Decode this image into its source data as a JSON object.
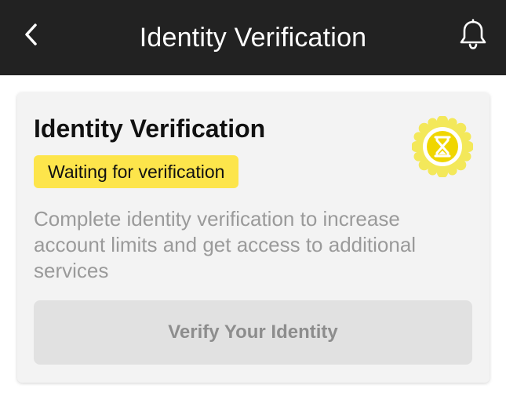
{
  "header": {
    "title": "Identity Verification",
    "back_icon": "chevron-left-icon",
    "notification_icon": "bell-icon",
    "background_color": "#222222"
  },
  "card": {
    "title": "Identity Verification",
    "status_badge": "Waiting for verification",
    "status_color": "#fde54b",
    "badge_icon": "hourglass-seal-icon",
    "description": "Complete identity verification to increase account limits and get access to additional services",
    "verify_button": "Verify Your Identity"
  }
}
